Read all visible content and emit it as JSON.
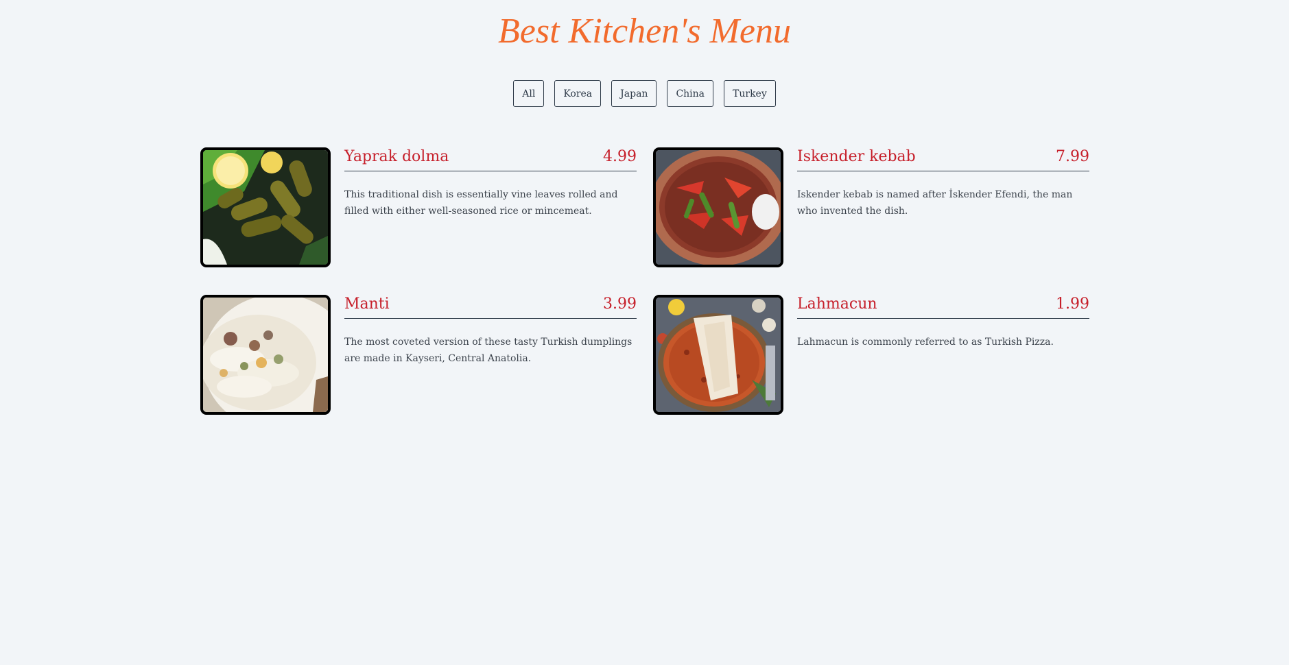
{
  "page": {
    "title": "Best Kitchen's Menu"
  },
  "filters": [
    {
      "label": "All"
    },
    {
      "label": "Korea"
    },
    {
      "label": "Japan"
    },
    {
      "label": "China"
    },
    {
      "label": "Turkey"
    }
  ],
  "menu": {
    "items": [
      {
        "title": "Yaprak dolma",
        "price": "4.99",
        "description": "This traditional dish is essentially vine leaves rolled and filled with either well-seasoned rice or mincemeat.",
        "image": "yaprak-dolma-photo"
      },
      {
        "title": "Iskender kebab",
        "price": "7.99",
        "description": "Iskender kebab is named after İskender Efendi, the man who invented the dish.",
        "image": "iskender-kebab-photo"
      },
      {
        "title": "Manti",
        "price": "3.99",
        "description": "The most coveted version of these tasty Turkish dumplings are made in Kayseri, Central Anatolia.",
        "image": "manti-photo"
      },
      {
        "title": "Lahmacun",
        "price": "1.99",
        "description": "Lahmacun is commonly referred to as Turkish Pizza.",
        "image": "lahmacun-photo"
      }
    ]
  },
  "colors": {
    "background": "#f2f5f8",
    "title": "#f26b2d",
    "item_accent": "#c61f2a",
    "text": "#3c434c",
    "border": "#2e3a48"
  }
}
